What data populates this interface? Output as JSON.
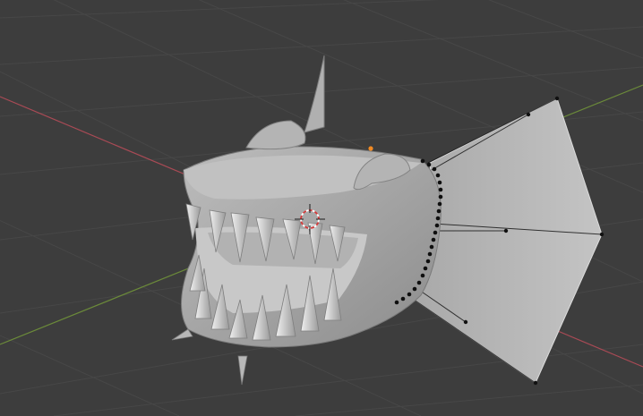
{
  "viewport": {
    "background_color": "#3d3d3d",
    "grid_color": "#474747",
    "x_axis_color": "#a84a55",
    "y_axis_color": "#6b8a3a"
  },
  "model": {
    "body_color": "#a2a2a2",
    "mouth_color": "#c8c8c8",
    "tooth_color": "#d6d6d6",
    "fin_color": "#b9b9b9",
    "selected_vertex_color": "#0f0f0f",
    "origin_color": "#f08a24"
  },
  "scene": {
    "icons": [
      "3d-cursor-icon",
      "object-origin-icon"
    ]
  }
}
